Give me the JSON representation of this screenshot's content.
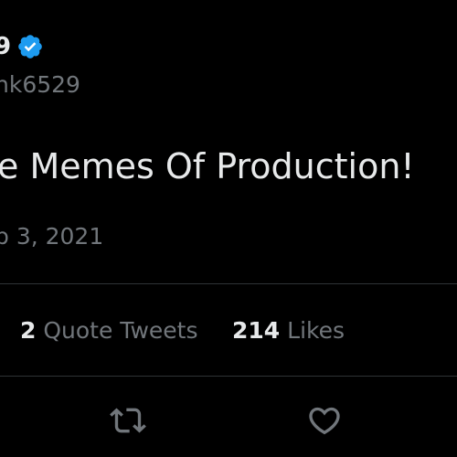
{
  "tweet": {
    "author_name": "9",
    "author_handle": "nk6529",
    "text": "e Memes Of Production!",
    "date": "b 3, 2021"
  },
  "stats": {
    "quote_tweets_count": "2",
    "quote_tweets_label": "Quote Tweets",
    "likes_count": "214",
    "likes_label": "Likes"
  },
  "actions": {
    "retweet_icon": "retweet-icon",
    "like_icon": "heart-icon"
  },
  "colors": {
    "background": "#000000",
    "primary_text": "#e7e9ea",
    "secondary_text": "#71767b",
    "divider": "#2f3336",
    "verified_badge": "#1d9bf0"
  }
}
